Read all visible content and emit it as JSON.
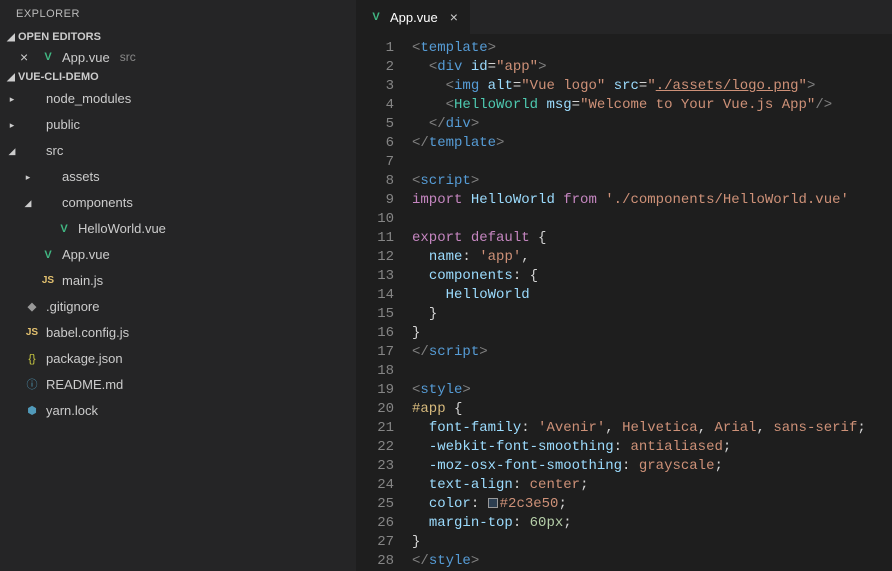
{
  "sidebar": {
    "title": "EXPLORER",
    "openEditors": {
      "title": "OPEN EDITORS",
      "items": [
        {
          "name": "App.vue",
          "dir": "src"
        }
      ]
    },
    "project": {
      "title": "VUE-CLI-DEMO",
      "tree": [
        {
          "label": "node_modules",
          "type": "folder",
          "expanded": false,
          "indent": 0
        },
        {
          "label": "public",
          "type": "folder",
          "expanded": false,
          "indent": 0
        },
        {
          "label": "src",
          "type": "folder",
          "expanded": true,
          "indent": 0
        },
        {
          "label": "assets",
          "type": "folder",
          "expanded": false,
          "indent": 1
        },
        {
          "label": "components",
          "type": "folder",
          "expanded": true,
          "indent": 1
        },
        {
          "label": "HelloWorld.vue",
          "type": "vue",
          "indent": 2
        },
        {
          "label": "App.vue",
          "type": "vue",
          "indent": 1
        },
        {
          "label": "main.js",
          "type": "js",
          "indent": 1
        },
        {
          "label": ".gitignore",
          "type": "git",
          "indent": 0
        },
        {
          "label": "babel.config.js",
          "type": "js",
          "indent": 0
        },
        {
          "label": "package.json",
          "type": "json",
          "indent": 0
        },
        {
          "label": "README.md",
          "type": "info",
          "indent": 0
        },
        {
          "label": "yarn.lock",
          "type": "yarn",
          "indent": 0
        }
      ]
    }
  },
  "tab": {
    "name": "App.vue"
  },
  "code": {
    "lines": [
      [
        {
          "c": "t-tag",
          "t": "<"
        },
        {
          "c": "t-name",
          "t": "template"
        },
        {
          "c": "t-tag",
          "t": ">"
        }
      ],
      [
        {
          "c": "",
          "t": "  "
        },
        {
          "c": "t-tag",
          "t": "<"
        },
        {
          "c": "t-name",
          "t": "div"
        },
        {
          "c": "",
          "t": " "
        },
        {
          "c": "t-attr",
          "t": "id"
        },
        {
          "c": "t-punc",
          "t": "="
        },
        {
          "c": "t-str",
          "t": "\"app\""
        },
        {
          "c": "t-tag",
          "t": ">"
        }
      ],
      [
        {
          "c": "",
          "t": "    "
        },
        {
          "c": "t-tag",
          "t": "<"
        },
        {
          "c": "t-name",
          "t": "img"
        },
        {
          "c": "",
          "t": " "
        },
        {
          "c": "t-attr",
          "t": "alt"
        },
        {
          "c": "t-punc",
          "t": "="
        },
        {
          "c": "t-str",
          "t": "\"Vue logo\""
        },
        {
          "c": "",
          "t": " "
        },
        {
          "c": "t-attr",
          "t": "src"
        },
        {
          "c": "t-punc",
          "t": "="
        },
        {
          "c": "t-str",
          "t": "\""
        },
        {
          "c": "t-link",
          "t": "./assets/logo.png"
        },
        {
          "c": "t-str",
          "t": "\""
        },
        {
          "c": "t-tag",
          "t": ">"
        }
      ],
      [
        {
          "c": "",
          "t": "    "
        },
        {
          "c": "t-tag",
          "t": "<"
        },
        {
          "c": "t-class",
          "t": "HelloWorld"
        },
        {
          "c": "",
          "t": " "
        },
        {
          "c": "t-attr",
          "t": "msg"
        },
        {
          "c": "t-punc",
          "t": "="
        },
        {
          "c": "t-str",
          "t": "\"Welcome to Your Vue.js App\""
        },
        {
          "c": "t-tag",
          "t": "/>"
        }
      ],
      [
        {
          "c": "",
          "t": "  "
        },
        {
          "c": "t-tag",
          "t": "</"
        },
        {
          "c": "t-name",
          "t": "div"
        },
        {
          "c": "t-tag",
          "t": ">"
        }
      ],
      [
        {
          "c": "t-tag",
          "t": "</"
        },
        {
          "c": "t-name",
          "t": "template"
        },
        {
          "c": "t-tag",
          "t": ">"
        }
      ],
      [],
      [
        {
          "c": "t-tag",
          "t": "<"
        },
        {
          "c": "t-name",
          "t": "script"
        },
        {
          "c": "t-tag",
          "t": ">"
        }
      ],
      [
        {
          "c": "t-kw",
          "t": "import"
        },
        {
          "c": "",
          "t": " "
        },
        {
          "c": "t-ident",
          "t": "HelloWorld"
        },
        {
          "c": "",
          "t": " "
        },
        {
          "c": "t-kw",
          "t": "from"
        },
        {
          "c": "",
          "t": " "
        },
        {
          "c": "t-str",
          "t": "'./components/HelloWorld.vue'"
        }
      ],
      [],
      [
        {
          "c": "t-kw",
          "t": "export"
        },
        {
          "c": "",
          "t": " "
        },
        {
          "c": "t-kw",
          "t": "default"
        },
        {
          "c": "",
          "t": " "
        },
        {
          "c": "t-punc",
          "t": "{"
        }
      ],
      [
        {
          "c": "",
          "t": "  "
        },
        {
          "c": "t-ident",
          "t": "name"
        },
        {
          "c": "t-punc",
          "t": ": "
        },
        {
          "c": "t-str",
          "t": "'app'"
        },
        {
          "c": "t-punc",
          "t": ","
        }
      ],
      [
        {
          "c": "",
          "t": "  "
        },
        {
          "c": "t-ident",
          "t": "components"
        },
        {
          "c": "t-punc",
          "t": ": {"
        }
      ],
      [
        {
          "c": "",
          "t": "    "
        },
        {
          "c": "t-ident",
          "t": "HelloWorld"
        }
      ],
      [
        {
          "c": "",
          "t": "  "
        },
        {
          "c": "t-punc",
          "t": "}"
        }
      ],
      [
        {
          "c": "t-punc",
          "t": "}"
        }
      ],
      [
        {
          "c": "t-tag",
          "t": "</"
        },
        {
          "c": "t-name",
          "t": "script"
        },
        {
          "c": "t-tag",
          "t": ">"
        }
      ],
      [],
      [
        {
          "c": "t-tag",
          "t": "<"
        },
        {
          "c": "t-name",
          "t": "style"
        },
        {
          "c": "t-tag",
          "t": ">"
        }
      ],
      [
        {
          "c": "t-sel",
          "t": "#app"
        },
        {
          "c": "",
          "t": " "
        },
        {
          "c": "t-punc",
          "t": "{"
        }
      ],
      [
        {
          "c": "",
          "t": "  "
        },
        {
          "c": "t-prop",
          "t": "font-family"
        },
        {
          "c": "t-punc",
          "t": ": "
        },
        {
          "c": "t-val",
          "t": "'Avenir'"
        },
        {
          "c": "t-punc",
          "t": ", "
        },
        {
          "c": "t-val",
          "t": "Helvetica"
        },
        {
          "c": "t-punc",
          "t": ", "
        },
        {
          "c": "t-val",
          "t": "Arial"
        },
        {
          "c": "t-punc",
          "t": ", "
        },
        {
          "c": "t-val",
          "t": "sans-serif"
        },
        {
          "c": "t-punc",
          "t": ";"
        }
      ],
      [
        {
          "c": "",
          "t": "  "
        },
        {
          "c": "t-prop",
          "t": "-webkit-font-smoothing"
        },
        {
          "c": "t-punc",
          "t": ": "
        },
        {
          "c": "t-val",
          "t": "antialiased"
        },
        {
          "c": "t-punc",
          "t": ";"
        }
      ],
      [
        {
          "c": "",
          "t": "  "
        },
        {
          "c": "t-prop",
          "t": "-moz-osx-font-smoothing"
        },
        {
          "c": "t-punc",
          "t": ": "
        },
        {
          "c": "t-val",
          "t": "grayscale"
        },
        {
          "c": "t-punc",
          "t": ";"
        }
      ],
      [
        {
          "c": "",
          "t": "  "
        },
        {
          "c": "t-prop",
          "t": "text-align"
        },
        {
          "c": "t-punc",
          "t": ": "
        },
        {
          "c": "t-val",
          "t": "center"
        },
        {
          "c": "t-punc",
          "t": ";"
        }
      ],
      [
        {
          "c": "",
          "t": "  "
        },
        {
          "c": "t-prop",
          "t": "color"
        },
        {
          "c": "t-punc",
          "t": ": "
        },
        {
          "c": "swatch",
          "t": ""
        },
        {
          "c": "t-val",
          "t": "#2c3e50"
        },
        {
          "c": "t-punc",
          "t": ";"
        }
      ],
      [
        {
          "c": "",
          "t": "  "
        },
        {
          "c": "t-prop",
          "t": "margin-top"
        },
        {
          "c": "t-punc",
          "t": ": "
        },
        {
          "c": "t-num",
          "t": "60px"
        },
        {
          "c": "t-punc",
          "t": ";"
        }
      ],
      [
        {
          "c": "t-punc",
          "t": "}"
        }
      ],
      [
        {
          "c": "t-tag",
          "t": "</"
        },
        {
          "c": "t-name",
          "t": "style"
        },
        {
          "c": "t-tag",
          "t": ">"
        }
      ]
    ]
  }
}
